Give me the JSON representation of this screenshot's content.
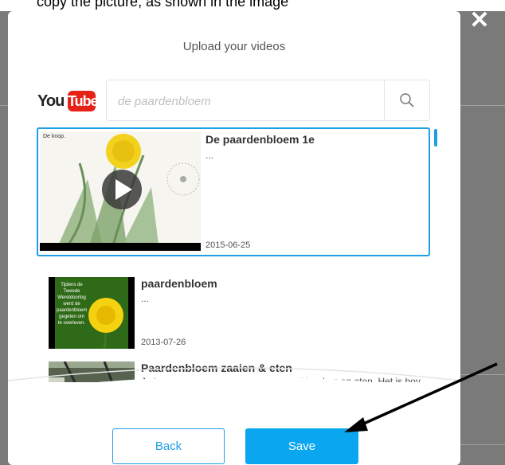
{
  "background_snippet": "copy the picture, as shown in the image",
  "modal": {
    "title": "Upload your videos",
    "youtube_logo": {
      "you": "You",
      "tube": "Tube"
    },
    "search": {
      "value": "",
      "placeholder": "de paardenbloem",
      "icon": "search-icon"
    },
    "results": [
      {
        "title": "De paardenbloem 1e",
        "description": "...",
        "date": "2015-06-25",
        "selected": true,
        "thumb_text": "De knop."
      },
      {
        "title": "paardenbloem",
        "description": "...",
        "date": "2013-07-26",
        "selected": false,
        "thumb_text": "Tijdens de Tweede Wereldoorlog werd de paardenbloem gegeten om te overleven."
      },
      {
        "title": "Paardenbloem zaaien & eten",
        "description": "Je kan paardenbloemen makkelijk zelf kweken en eten. Het is bov",
        "date": "",
        "selected": false
      }
    ],
    "buttons": {
      "back": "Back",
      "save": "Save"
    }
  },
  "colors": {
    "accent": "#1e9fe6",
    "save": "#0aa7f0",
    "youtube_red": "#e62117"
  }
}
